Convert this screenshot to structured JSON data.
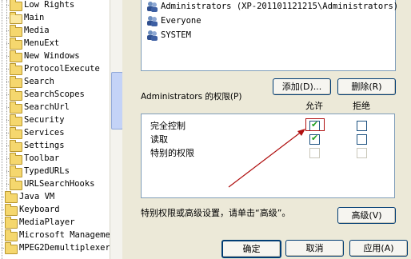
{
  "tree": {
    "items": [
      {
        "label": "Low Rights",
        "type": "folder"
      },
      {
        "label": "Main",
        "type": "folder-open"
      },
      {
        "label": "Media",
        "type": "folder"
      },
      {
        "label": "MenuExt",
        "type": "folder"
      },
      {
        "label": "New Windows",
        "type": "folder"
      },
      {
        "label": "ProtocolExecute",
        "type": "folder"
      },
      {
        "label": "Search",
        "type": "folder"
      },
      {
        "label": "SearchScopes",
        "type": "folder"
      },
      {
        "label": "SearchUrl",
        "type": "folder"
      },
      {
        "label": "Security",
        "type": "folder"
      },
      {
        "label": "Services",
        "type": "folder"
      },
      {
        "label": "Settings",
        "type": "folder"
      },
      {
        "label": "Toolbar",
        "type": "folder"
      },
      {
        "label": "TypedURLs",
        "type": "folder"
      },
      {
        "label": "URLSearchHooks",
        "type": "folder"
      },
      {
        "label": "Java VM",
        "type": "folder"
      },
      {
        "label": "Keyboard",
        "type": "folder"
      },
      {
        "label": "MediaPlayer",
        "type": "folder"
      },
      {
        "label": "Microsoft Management C",
        "type": "folder"
      },
      {
        "label": "MPEG2Demultiplexer",
        "type": "folder"
      }
    ]
  },
  "users": [
    {
      "name": "Administrators (XP-201101121215\\Administrators)"
    },
    {
      "name": "Everyone"
    },
    {
      "name": "SYSTEM"
    }
  ],
  "buttons": {
    "add": "添加(D)...",
    "remove": "删除(R)",
    "advanced": "高级(V)",
    "ok": "确定",
    "cancel": "取消",
    "apply": "应用(A)"
  },
  "permissions": {
    "label": "Administrators 的权限(P)",
    "allow_header": "允许",
    "deny_header": "拒绝",
    "rows": [
      {
        "name": "完全控制",
        "allow": true,
        "deny": false,
        "disabled": false
      },
      {
        "name": "读取",
        "allow": true,
        "deny": false,
        "disabled": false
      },
      {
        "name": "特别的权限",
        "allow": false,
        "deny": false,
        "disabled": true
      }
    ]
  },
  "advanced_note": "特别权限或高级设置，请单击“高级”。",
  "colors": {
    "accent": "#003c74",
    "annotation": "#b01010",
    "check": "#21a121"
  }
}
